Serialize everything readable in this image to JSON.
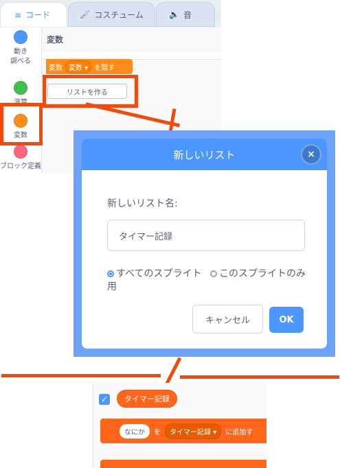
{
  "editor": {
    "tabs": [
      {
        "label": "コード",
        "icon": "code-icon"
      },
      {
        "label": "コスチューム",
        "icon": "brush-icon"
      },
      {
        "label": "音",
        "icon": "speaker-icon"
      }
    ],
    "categories": [
      {
        "label": "動き",
        "color": "#4c97ff"
      },
      {
        "label": "調べる",
        "color": "#5cb1d6"
      },
      {
        "label": "演算",
        "color": "#40bf4a"
      },
      {
        "label": "変数",
        "color": "#ff8c1a"
      },
      {
        "label": "ブロック定義",
        "color": "#ff6680"
      }
    ],
    "palette_title": "変数",
    "block": {
      "prefix": "変数",
      "dropdown": "変数",
      "suffix": "を隠す"
    },
    "make_list_button": "リストを作る"
  },
  "dialog": {
    "title": "新しいリスト",
    "close": "×",
    "field_label": "新しいリスト名:",
    "input_value": "タイマー記録",
    "radio_all": "すべてのスプライト用",
    "radio_this": "このスプライトのみ",
    "cancel": "キャンセル",
    "ok": "OK"
  },
  "result": {
    "checkbox": "✓",
    "list_reporter": "タイマー記録",
    "add_block": {
      "item": "なにか",
      "to": "を",
      "list": "タイマー記録",
      "suffix": "に追加す"
    }
  },
  "colors": {
    "accent": "#4c97ff",
    "highlight": "#f24a0c",
    "variables": "#ff8c1a",
    "list": "#ff661a"
  }
}
